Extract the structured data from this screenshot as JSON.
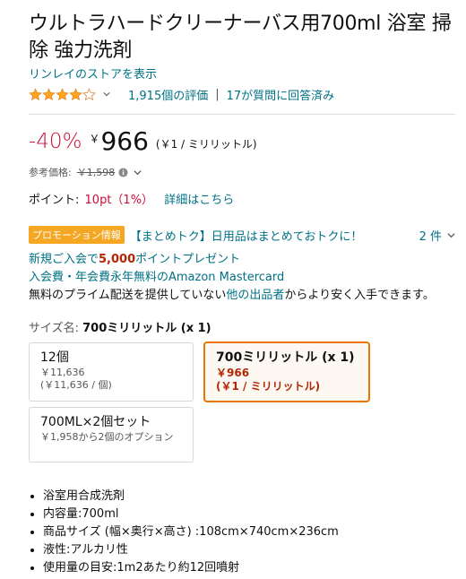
{
  "product": {
    "title": "ウルトラハードクリーナーバス用700ml 浴室 掃除 強力洗剤",
    "store_link": "リンレイのストアを表示",
    "rating_count": "1,915個の評価",
    "qa_link": "17が質問に回答済み",
    "stars_filled": 4
  },
  "price": {
    "discount": "-40%",
    "currency": "￥",
    "whole": "966",
    "unit_price": "(￥1 / ミリリットル)",
    "ref_label": "参考価格:",
    "ref_price": "￥1,598"
  },
  "points": {
    "label": "ポイント:",
    "value": "10pt（1%）",
    "details_link": "詳細はこちら"
  },
  "promo": {
    "badge": "プロモーション情報",
    "text": "【まとめトク】日用品はまとめておトクに！",
    "count": "2 件"
  },
  "offers": {
    "signup_prefix": "新規ご入会で",
    "signup_amount": "5,000",
    "signup_suffix": "ポイントプレゼント",
    "card": "入会費・年会費永年無料のAmazon Mastercard",
    "prime_prefix": "無料のプライム配送を提供していない",
    "prime_link": "他の出品者",
    "prime_suffix": "からより安く入手できます。"
  },
  "size": {
    "label": "サイズ名: ",
    "selected": "700ミリリットル (x 1)",
    "options": [
      {
        "title": "12個",
        "line1": "￥11,636",
        "line2": "(￥11,636 / 個)"
      },
      {
        "title": "700ミリリットル (x 1)",
        "line1": "￥966",
        "line2": "(￥1 / ミリリットル)"
      },
      {
        "title": "700ML×2個セット",
        "line1": "￥1,958から2個のオプション"
      }
    ]
  },
  "bullets": [
    "浴室用合成洗剤",
    "内容量:700ml",
    "商品サイズ (幅×奥行×高さ) :108cm×740cm×236cm",
    "液性:アルカリ性",
    "使用量の目安:1m2あたり約12回噴射"
  ],
  "colors": {
    "link": "#007185",
    "price_red": "#CC0C39",
    "star": "#FFA41C",
    "selected_border": "#E77600"
  }
}
